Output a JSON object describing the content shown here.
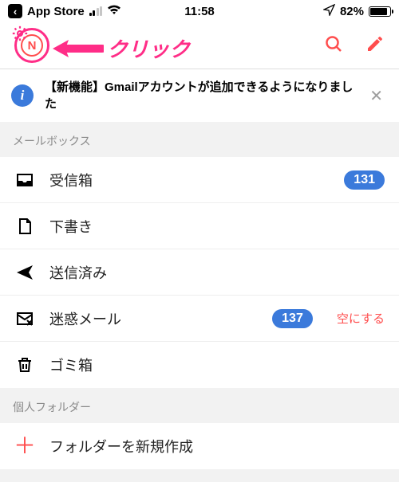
{
  "statusbar": {
    "back_app": "App Store",
    "time": "11:58",
    "battery_pct": "82%",
    "battery_level_css_width": "80%"
  },
  "header": {
    "avatar_letter": "N",
    "annotation": "クリック"
  },
  "banner": {
    "text": "【新機能】Gmailアカウントが追加できるようになりました"
  },
  "sections": {
    "mailboxes_label": "メールボックス",
    "personal_label": "個人フォルダー"
  },
  "mailboxes": {
    "inbox": {
      "label": "受信箱",
      "badge": "131"
    },
    "drafts": {
      "label": "下書き"
    },
    "sent": {
      "label": "送信済み"
    },
    "spam": {
      "label": "迷惑メール",
      "badge": "137",
      "action": "空にする"
    },
    "trash": {
      "label": "ゴミ箱"
    }
  },
  "personal": {
    "new_folder": "フォルダーを新規作成"
  }
}
